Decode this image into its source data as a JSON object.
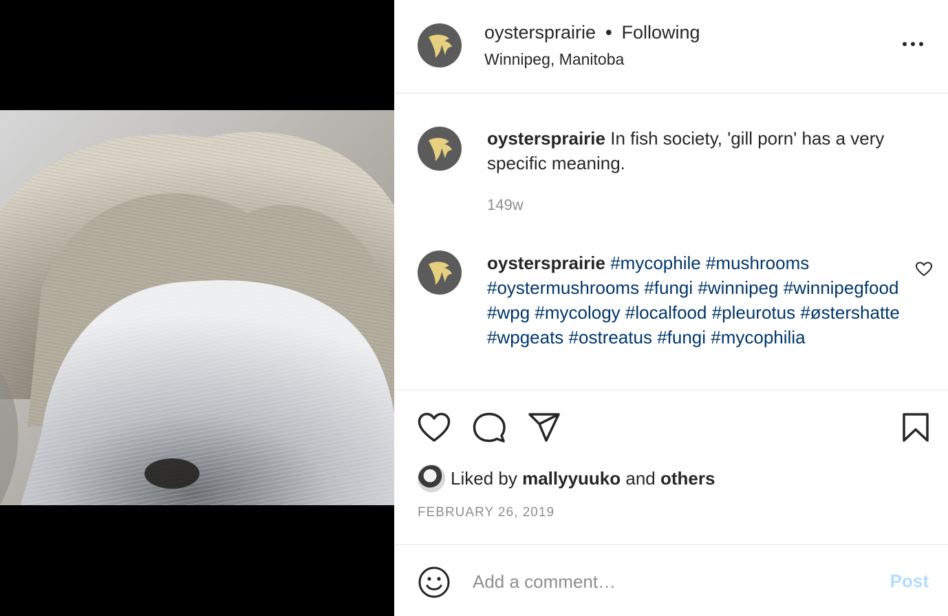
{
  "post": {
    "username": "oystersprairie",
    "follow_separator": "•",
    "follow_status": "Following",
    "location": "Winnipeg, Manitoba"
  },
  "caption": {
    "username": "oystersprairie",
    "text": "In fish society, 'gill porn' has a very specific meaning.",
    "time": "149w"
  },
  "comment": {
    "username": "oystersprairie",
    "hashtags": [
      "#mycophile",
      "#mushrooms",
      "#oystermushrooms",
      "#fungi",
      "#winnipeg",
      "#winnipegfood",
      "#wpg",
      "#mycology",
      "#localfood",
      "#pleurotus",
      "#østershatte",
      "#wpgeats",
      "#ostreatus",
      "#fungi",
      "#mycophilia"
    ]
  },
  "likes": {
    "prefix": "Liked by",
    "user": "mallyyuuko",
    "conjunction": "and",
    "others": "others"
  },
  "date": "FEBRUARY 26, 2019",
  "composer": {
    "placeholder": "Add a comment…",
    "post_label": "Post"
  },
  "colors": {
    "hashtag": "#00376b",
    "post_disabled": "#b3dbff",
    "avatar_bg": "#5b5b5b",
    "logo": "#e6cf7f"
  },
  "icons": [
    "more-options-icon",
    "heart-icon",
    "comment-icon",
    "share-icon",
    "bookmark-icon",
    "small-heart-icon",
    "emoji-icon",
    "oyster-logo-icon"
  ]
}
